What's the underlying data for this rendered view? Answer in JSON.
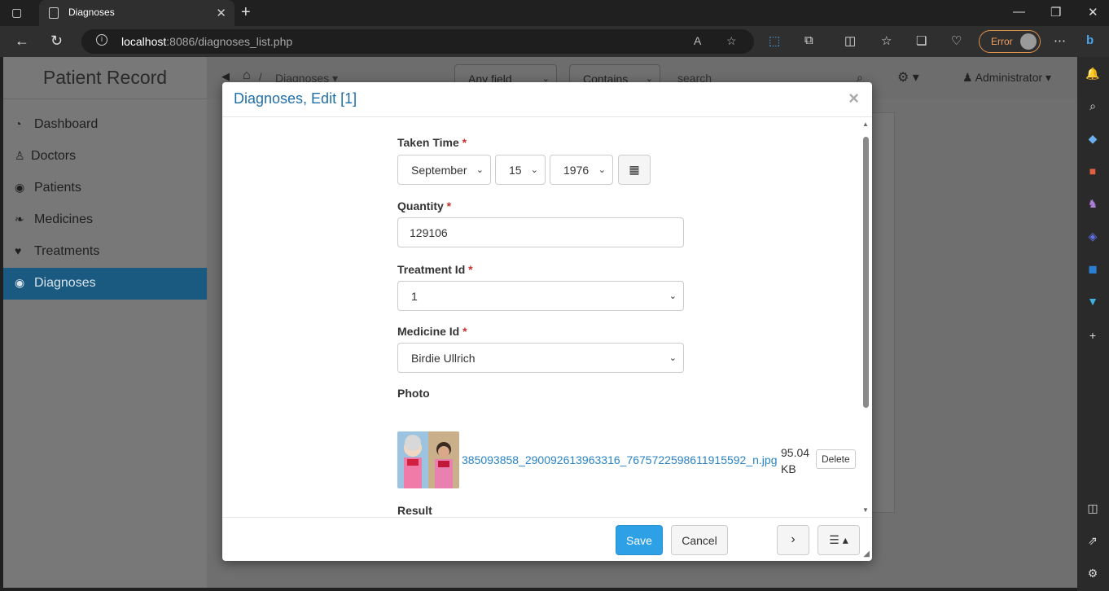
{
  "browser": {
    "tab_title": "Diagnoses",
    "url_host": "localhost",
    "url_path": ":8086/diagnoses_list.php",
    "error_label": "Error"
  },
  "app": {
    "brand": "Patient Record",
    "menu": [
      {
        "label": "Dashboard",
        "icon": "dashboard-icon"
      },
      {
        "label": "Doctors",
        "icon": "user-md-icon"
      },
      {
        "label": "Patients",
        "icon": "user-circle-icon"
      },
      {
        "label": "Medicines",
        "icon": "leaf-icon"
      },
      {
        "label": "Treatments",
        "icon": "heart-icon"
      },
      {
        "label": "Diagnoses",
        "icon": "eye-icon"
      }
    ],
    "breadcrumb": "Diagnoses",
    "search": {
      "field_select": "Any field",
      "operator_select": "Contains",
      "placeholder": "search"
    },
    "user": "Administrator"
  },
  "modal": {
    "title": "Diagnoses, Edit [1]",
    "close": "×",
    "fields": {
      "taken_time": {
        "label": "Taken Time",
        "month": "September",
        "day": "15",
        "year": "1976"
      },
      "quantity": {
        "label": "Quantity",
        "value": "129106"
      },
      "treatment_id": {
        "label": "Treatment Id",
        "value": "1"
      },
      "medicine_id": {
        "label": "Medicine Id",
        "value": "Birdie Ullrich"
      },
      "photo": {
        "label": "Photo",
        "filename": "385093858_290092613963316_7675722598611915592_n.jpg",
        "size_value": "95.04",
        "size_unit": "KB",
        "delete_label": "Delete"
      },
      "result": {
        "label": "Result"
      }
    },
    "required_mark": "*",
    "footer": {
      "save_label": "Save",
      "cancel_label": "Cancel"
    }
  },
  "colors": {
    "accent": "#2ea1e6",
    "title_blue": "#1f6ea8",
    "link_blue": "#2a83c6",
    "active_menu": "#1a5a80",
    "required_red": "#c9302c"
  }
}
